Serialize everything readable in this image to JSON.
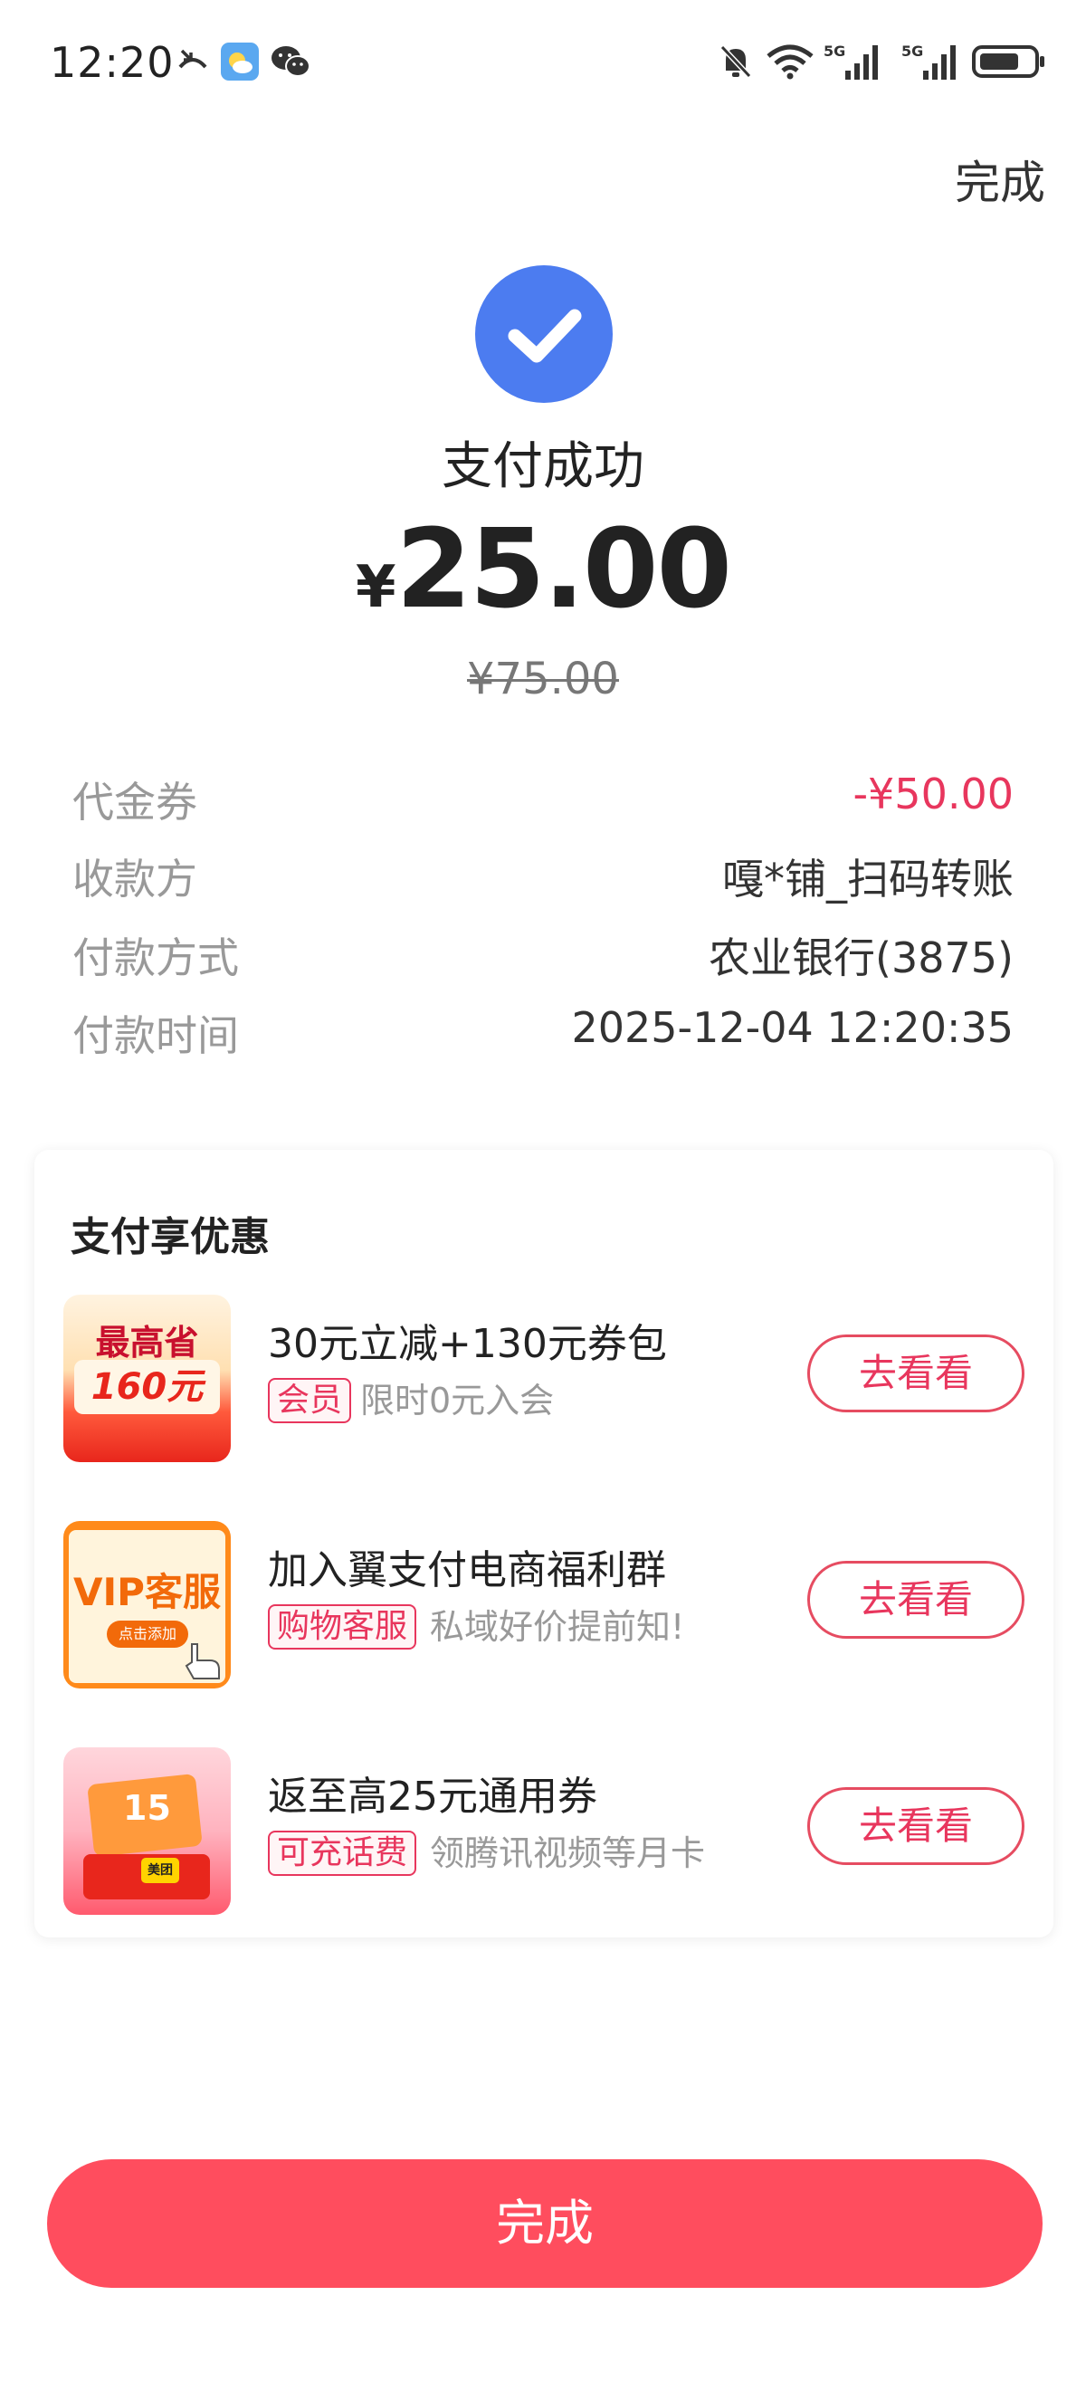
{
  "status_bar": {
    "time": "12:20",
    "network_left": "5G",
    "network_right": "5G"
  },
  "header": {
    "done_label": "完成"
  },
  "result": {
    "title": "支付成功",
    "currency": "¥",
    "amount": "25.00",
    "original_amount": "¥75.00",
    "accent_color": "#4c7cf0"
  },
  "details": [
    {
      "label": "代金券",
      "value": "-¥50.00",
      "highlight": true
    },
    {
      "label": "收款方",
      "value": "嘎*铺_扫码转账",
      "highlight": false
    },
    {
      "label": "付款方式",
      "value": "农业银行(3875)",
      "highlight": false
    },
    {
      "label": "付款时间",
      "value": "2025-12-04 12:20:35",
      "highlight": false
    }
  ],
  "promotions": {
    "title": "支付享优惠",
    "items": [
      {
        "title": "30元立减+130元券包",
        "tag": "会员",
        "desc": "限时0元入会",
        "button": "去看看",
        "thumb_line1": "最高省",
        "thumb_line2": "160元"
      },
      {
        "title": "加入翼支付电商福利群",
        "tag": "购物客服",
        "desc": "私域好价提前知!",
        "button": "去看看",
        "thumb_line1": "VIP客服",
        "thumb_line2": "点击添加"
      },
      {
        "title": "返至高25元通用券",
        "tag": "可充话费",
        "desc": "领腾讯视频等月卡",
        "button": "去看看",
        "thumb_line1": "15",
        "thumb_line2": "美团"
      }
    ]
  },
  "footer": {
    "done_label": "完成",
    "button_color": "#ff4d5e"
  }
}
